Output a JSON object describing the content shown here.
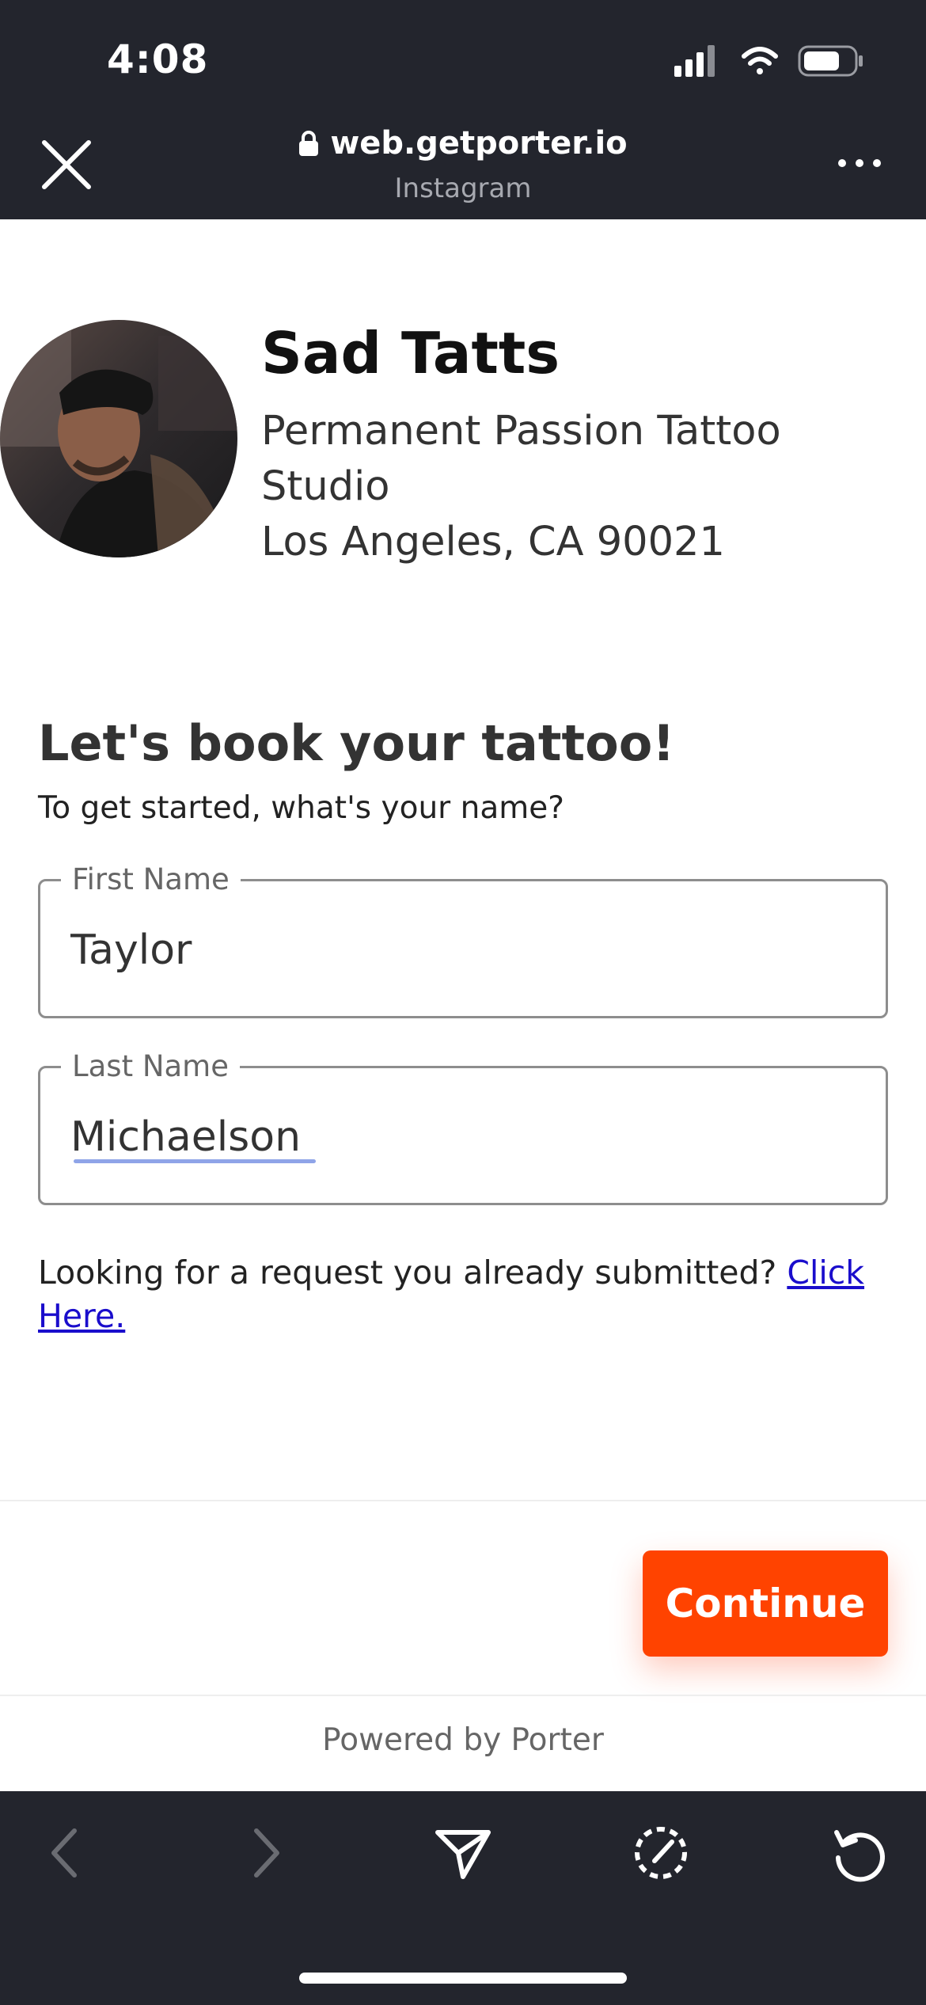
{
  "status_bar": {
    "time": "4:08",
    "icons": [
      "cellular-signal-icon",
      "wifi-icon",
      "battery-icon"
    ]
  },
  "browser": {
    "url": "web.getporter.io",
    "source": "Instagram",
    "icons": [
      "close-icon",
      "lock-icon",
      "more-icon"
    ]
  },
  "artist": {
    "name": "Sad Tatts",
    "studio_line_1": "Permanent Passion Tattoo",
    "studio_line_2": "Studio",
    "location": "Los Angeles, CA 90021"
  },
  "booking": {
    "heading": "Let's book your tattoo!",
    "prompt": "To get started, what's your name?",
    "first_name_label": "First Name",
    "first_name_value": "Taylor",
    "last_name_label": "Last Name",
    "last_name_value": "Michaelson",
    "lookup_text": "Looking for a request you already submitted?",
    "lookup_link": "Click Here."
  },
  "footer": {
    "continue_label": "Continue",
    "powered_by": "Powered by Porter"
  },
  "toolbar": {
    "icons": [
      "back-icon",
      "forward-icon",
      "share-icon",
      "safari-compass-icon",
      "reload-icon"
    ]
  },
  "colors": {
    "chrome_background": "#23252d",
    "accent": "#ff4300",
    "link": "#1a0dcc"
  }
}
